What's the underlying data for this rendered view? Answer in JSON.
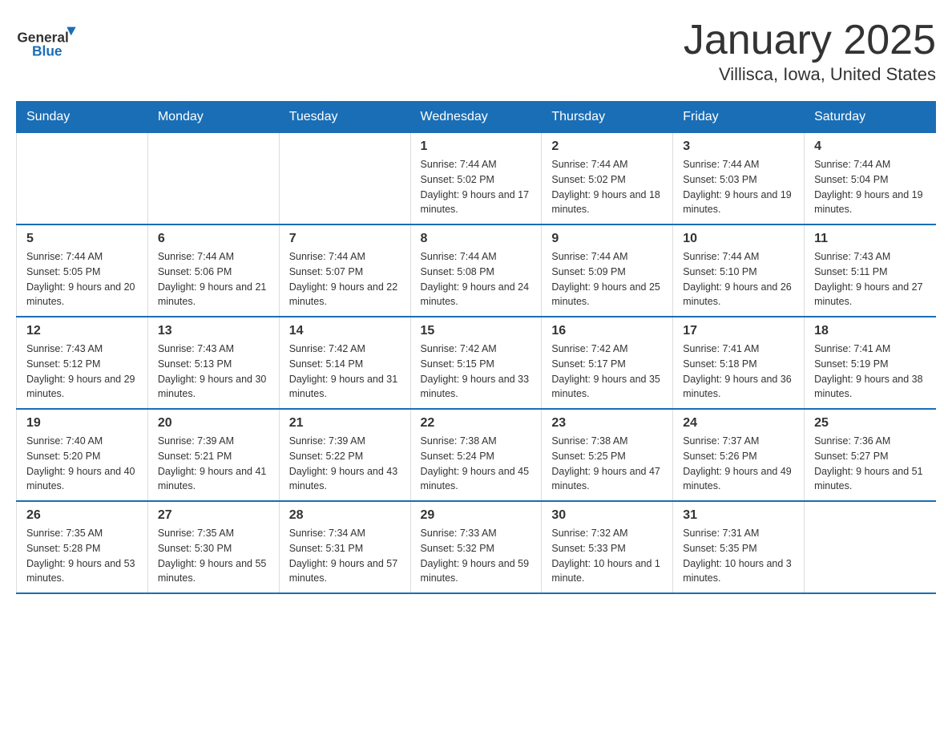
{
  "header": {
    "logo_general": "General",
    "logo_blue": "Blue",
    "title": "January 2025",
    "subtitle": "Villisca, Iowa, United States"
  },
  "calendar": {
    "days_of_week": [
      "Sunday",
      "Monday",
      "Tuesday",
      "Wednesday",
      "Thursday",
      "Friday",
      "Saturday"
    ],
    "weeks": [
      [
        {
          "day": "",
          "sunrise": "",
          "sunset": "",
          "daylight": ""
        },
        {
          "day": "",
          "sunrise": "",
          "sunset": "",
          "daylight": ""
        },
        {
          "day": "",
          "sunrise": "",
          "sunset": "",
          "daylight": ""
        },
        {
          "day": "1",
          "sunrise": "Sunrise: 7:44 AM",
          "sunset": "Sunset: 5:02 PM",
          "daylight": "Daylight: 9 hours and 17 minutes."
        },
        {
          "day": "2",
          "sunrise": "Sunrise: 7:44 AM",
          "sunset": "Sunset: 5:02 PM",
          "daylight": "Daylight: 9 hours and 18 minutes."
        },
        {
          "day": "3",
          "sunrise": "Sunrise: 7:44 AM",
          "sunset": "Sunset: 5:03 PM",
          "daylight": "Daylight: 9 hours and 19 minutes."
        },
        {
          "day": "4",
          "sunrise": "Sunrise: 7:44 AM",
          "sunset": "Sunset: 5:04 PM",
          "daylight": "Daylight: 9 hours and 19 minutes."
        }
      ],
      [
        {
          "day": "5",
          "sunrise": "Sunrise: 7:44 AM",
          "sunset": "Sunset: 5:05 PM",
          "daylight": "Daylight: 9 hours and 20 minutes."
        },
        {
          "day": "6",
          "sunrise": "Sunrise: 7:44 AM",
          "sunset": "Sunset: 5:06 PM",
          "daylight": "Daylight: 9 hours and 21 minutes."
        },
        {
          "day": "7",
          "sunrise": "Sunrise: 7:44 AM",
          "sunset": "Sunset: 5:07 PM",
          "daylight": "Daylight: 9 hours and 22 minutes."
        },
        {
          "day": "8",
          "sunrise": "Sunrise: 7:44 AM",
          "sunset": "Sunset: 5:08 PM",
          "daylight": "Daylight: 9 hours and 24 minutes."
        },
        {
          "day": "9",
          "sunrise": "Sunrise: 7:44 AM",
          "sunset": "Sunset: 5:09 PM",
          "daylight": "Daylight: 9 hours and 25 minutes."
        },
        {
          "day": "10",
          "sunrise": "Sunrise: 7:44 AM",
          "sunset": "Sunset: 5:10 PM",
          "daylight": "Daylight: 9 hours and 26 minutes."
        },
        {
          "day": "11",
          "sunrise": "Sunrise: 7:43 AM",
          "sunset": "Sunset: 5:11 PM",
          "daylight": "Daylight: 9 hours and 27 minutes."
        }
      ],
      [
        {
          "day": "12",
          "sunrise": "Sunrise: 7:43 AM",
          "sunset": "Sunset: 5:12 PM",
          "daylight": "Daylight: 9 hours and 29 minutes."
        },
        {
          "day": "13",
          "sunrise": "Sunrise: 7:43 AM",
          "sunset": "Sunset: 5:13 PM",
          "daylight": "Daylight: 9 hours and 30 minutes."
        },
        {
          "day": "14",
          "sunrise": "Sunrise: 7:42 AM",
          "sunset": "Sunset: 5:14 PM",
          "daylight": "Daylight: 9 hours and 31 minutes."
        },
        {
          "day": "15",
          "sunrise": "Sunrise: 7:42 AM",
          "sunset": "Sunset: 5:15 PM",
          "daylight": "Daylight: 9 hours and 33 minutes."
        },
        {
          "day": "16",
          "sunrise": "Sunrise: 7:42 AM",
          "sunset": "Sunset: 5:17 PM",
          "daylight": "Daylight: 9 hours and 35 minutes."
        },
        {
          "day": "17",
          "sunrise": "Sunrise: 7:41 AM",
          "sunset": "Sunset: 5:18 PM",
          "daylight": "Daylight: 9 hours and 36 minutes."
        },
        {
          "day": "18",
          "sunrise": "Sunrise: 7:41 AM",
          "sunset": "Sunset: 5:19 PM",
          "daylight": "Daylight: 9 hours and 38 minutes."
        }
      ],
      [
        {
          "day": "19",
          "sunrise": "Sunrise: 7:40 AM",
          "sunset": "Sunset: 5:20 PM",
          "daylight": "Daylight: 9 hours and 40 minutes."
        },
        {
          "day": "20",
          "sunrise": "Sunrise: 7:39 AM",
          "sunset": "Sunset: 5:21 PM",
          "daylight": "Daylight: 9 hours and 41 minutes."
        },
        {
          "day": "21",
          "sunrise": "Sunrise: 7:39 AM",
          "sunset": "Sunset: 5:22 PM",
          "daylight": "Daylight: 9 hours and 43 minutes."
        },
        {
          "day": "22",
          "sunrise": "Sunrise: 7:38 AM",
          "sunset": "Sunset: 5:24 PM",
          "daylight": "Daylight: 9 hours and 45 minutes."
        },
        {
          "day": "23",
          "sunrise": "Sunrise: 7:38 AM",
          "sunset": "Sunset: 5:25 PM",
          "daylight": "Daylight: 9 hours and 47 minutes."
        },
        {
          "day": "24",
          "sunrise": "Sunrise: 7:37 AM",
          "sunset": "Sunset: 5:26 PM",
          "daylight": "Daylight: 9 hours and 49 minutes."
        },
        {
          "day": "25",
          "sunrise": "Sunrise: 7:36 AM",
          "sunset": "Sunset: 5:27 PM",
          "daylight": "Daylight: 9 hours and 51 minutes."
        }
      ],
      [
        {
          "day": "26",
          "sunrise": "Sunrise: 7:35 AM",
          "sunset": "Sunset: 5:28 PM",
          "daylight": "Daylight: 9 hours and 53 minutes."
        },
        {
          "day": "27",
          "sunrise": "Sunrise: 7:35 AM",
          "sunset": "Sunset: 5:30 PM",
          "daylight": "Daylight: 9 hours and 55 minutes."
        },
        {
          "day": "28",
          "sunrise": "Sunrise: 7:34 AM",
          "sunset": "Sunset: 5:31 PM",
          "daylight": "Daylight: 9 hours and 57 minutes."
        },
        {
          "day": "29",
          "sunrise": "Sunrise: 7:33 AM",
          "sunset": "Sunset: 5:32 PM",
          "daylight": "Daylight: 9 hours and 59 minutes."
        },
        {
          "day": "30",
          "sunrise": "Sunrise: 7:32 AM",
          "sunset": "Sunset: 5:33 PM",
          "daylight": "Daylight: 10 hours and 1 minute."
        },
        {
          "day": "31",
          "sunrise": "Sunrise: 7:31 AM",
          "sunset": "Sunset: 5:35 PM",
          "daylight": "Daylight: 10 hours and 3 minutes."
        },
        {
          "day": "",
          "sunrise": "",
          "sunset": "",
          "daylight": ""
        }
      ]
    ]
  }
}
